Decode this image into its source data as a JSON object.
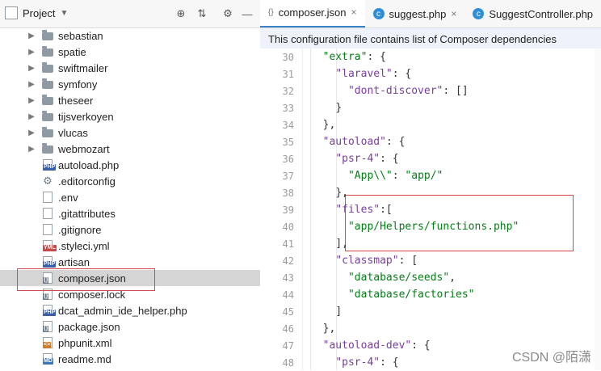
{
  "left_panel": {
    "title": "Project",
    "toolbar": {
      "locate_icon": "target-icon",
      "collapse_icon": "collapse-icon",
      "settings_icon": "gear-icon",
      "hide_icon": "minus-icon"
    },
    "items": [
      {
        "label": "sebastian",
        "type": "folder",
        "expanded": false
      },
      {
        "label": "spatie",
        "type": "folder",
        "expanded": false
      },
      {
        "label": "swiftmailer",
        "type": "folder",
        "expanded": false
      },
      {
        "label": "symfony",
        "type": "folder",
        "expanded": false
      },
      {
        "label": "theseer",
        "type": "folder",
        "expanded": false
      },
      {
        "label": "tijsverkoyen",
        "type": "folder",
        "expanded": false
      },
      {
        "label": "vlucas",
        "type": "folder",
        "expanded": false
      },
      {
        "label": "webmozart",
        "type": "folder",
        "expanded": false
      },
      {
        "label": "autoload.php",
        "type": "php"
      },
      {
        "label": ".editorconfig",
        "type": "gear"
      },
      {
        "label": ".env",
        "type": "file"
      },
      {
        "label": ".gitattributes",
        "type": "file"
      },
      {
        "label": ".gitignore",
        "type": "file"
      },
      {
        "label": ".styleci.yml",
        "type": "yml"
      },
      {
        "label": "artisan",
        "type": "php"
      },
      {
        "label": "composer.json",
        "type": "json",
        "selected": true
      },
      {
        "label": "composer.lock",
        "type": "json"
      },
      {
        "label": "dcat_admin_ide_helper.php",
        "type": "php"
      },
      {
        "label": "package.json",
        "type": "json"
      },
      {
        "label": "phpunit.xml",
        "type": "xml"
      },
      {
        "label": "readme.md",
        "type": "md"
      }
    ]
  },
  "tabs": [
    {
      "label": "composer.json",
      "active": true
    },
    {
      "label": "suggest.php",
      "active": false
    },
    {
      "label": "SuggestController.php",
      "active": false
    }
  ],
  "banner": "This configuration file contains list of Composer dependencies",
  "editor": {
    "lines": [
      {
        "n": "30",
        "html": "  <span class='str'>\"extra\"</span><span class='punc'>: {</span>"
      },
      {
        "n": "31",
        "html": "    <span class='key'>\"laravel\"</span><span class='punc'>: {</span>"
      },
      {
        "n": "32",
        "html": "      <span class='key'>\"dont-discover\"</span><span class='punc'>: []</span>"
      },
      {
        "n": "33",
        "html": "    <span class='punc'>}</span>"
      },
      {
        "n": "34",
        "html": "  <span class='punc'>},</span>"
      },
      {
        "n": "35",
        "html": "  <span class='key'>\"autoload\"</span><span class='punc'>: {</span>"
      },
      {
        "n": "36",
        "html": "    <span class='key'>\"psr-4\"</span><span class='punc'>: {</span>"
      },
      {
        "n": "37",
        "html": "      <span class='str'>\"App\\\\\"</span><span class='punc'>: </span><span class='str'>\"app/\"</span>"
      },
      {
        "n": "38",
        "html": "    <span class='punc'>},</span>"
      },
      {
        "n": "39",
        "html": "    <span class='key'>\"files\"</span><span class='punc'>:[</span>"
      },
      {
        "n": "40",
        "html": "      <span class='str'>\"app/Helpers/functions.php\"</span>"
      },
      {
        "n": "41",
        "html": "    <span class='punc'>],</span>"
      },
      {
        "n": "42",
        "html": "    <span class='key'>\"classmap\"</span><span class='punc'>: [</span>"
      },
      {
        "n": "43",
        "html": "      <span class='str'>\"database/seeds\"</span><span class='punc'>,</span>"
      },
      {
        "n": "44",
        "html": "      <span class='str'>\"database/factories\"</span>"
      },
      {
        "n": "45",
        "html": "    <span class='punc'>]</span>"
      },
      {
        "n": "46",
        "html": "  <span class='punc'>},</span>"
      },
      {
        "n": "47",
        "html": "  <span class='key'>\"autoload-dev\"</span><span class='punc'>: {</span>"
      },
      {
        "n": "48",
        "html": "    <span class='key'>\"psr-4\"</span><span class='punc'>: {</span>"
      }
    ]
  },
  "watermark": "CSDN @陌潇"
}
